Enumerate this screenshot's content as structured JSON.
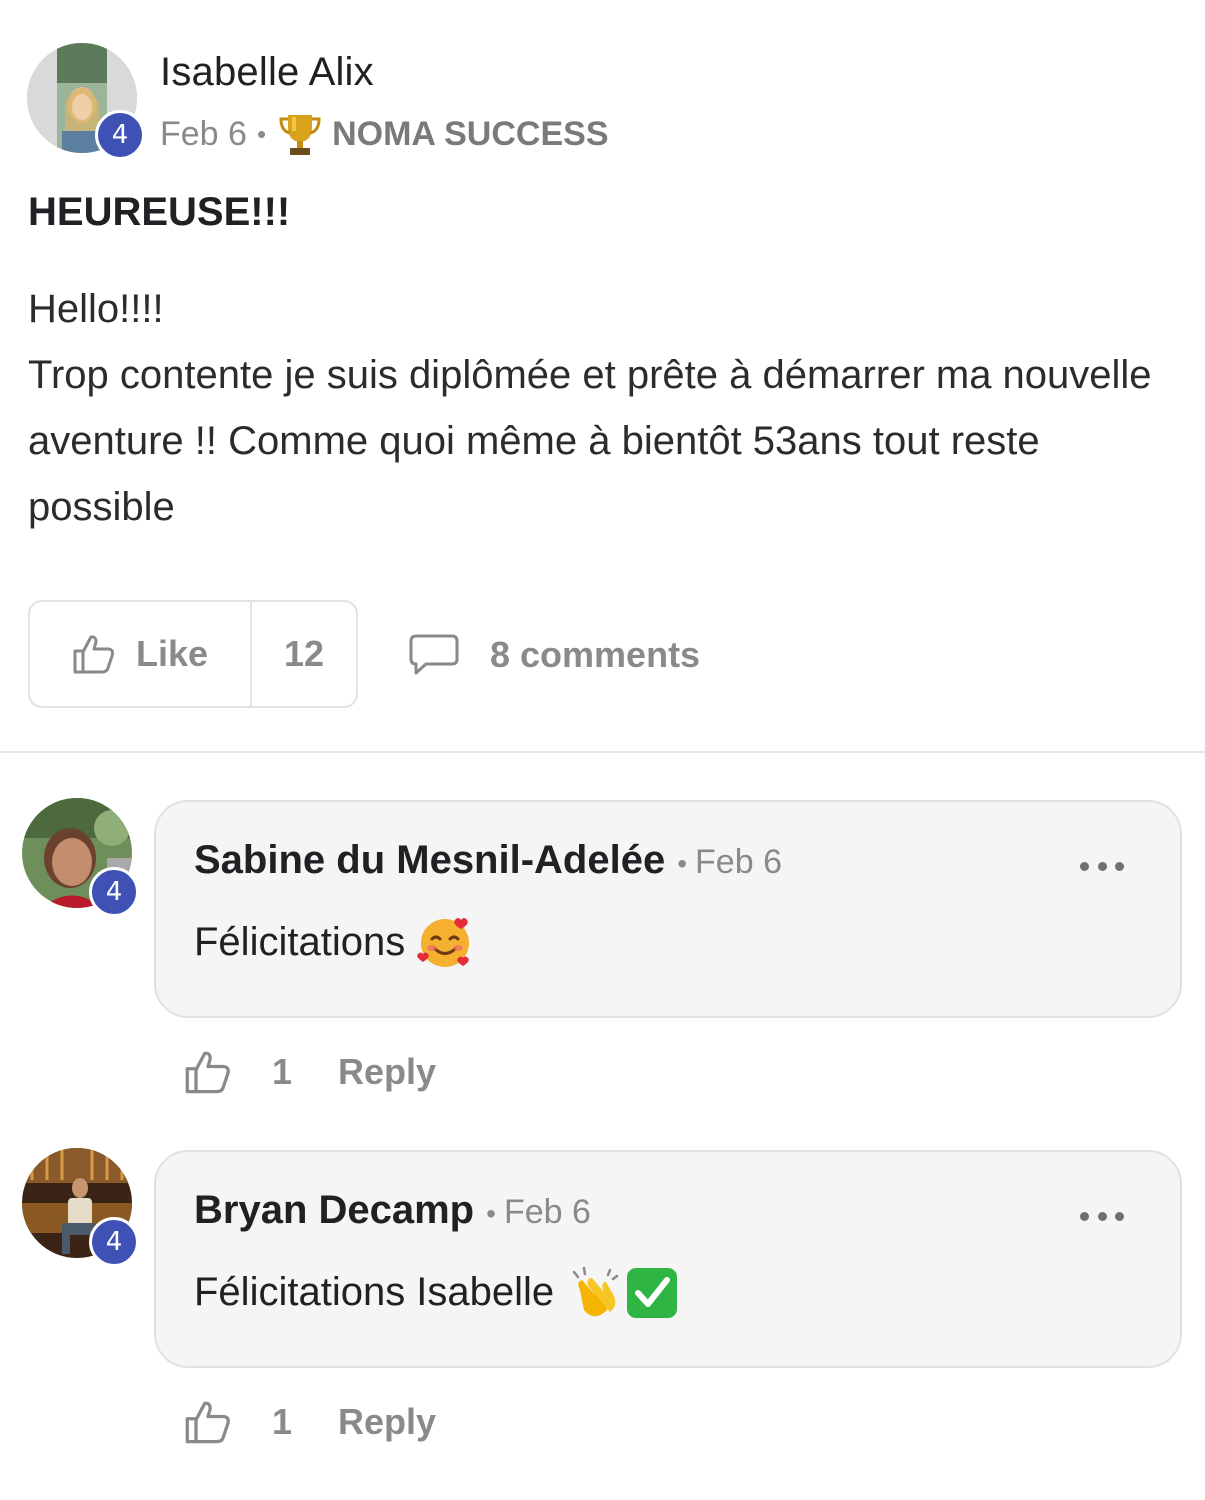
{
  "post": {
    "author": "Isabelle Alix",
    "author_level": "4",
    "date": "Feb 6",
    "separator": "•",
    "category": "NOMA SUCCESS",
    "category_icon": "trophy-icon",
    "title": "HEUREUSE!!!",
    "body_lines": [
      "Hello!!!!",
      "Trop contente je suis diplômée et prête à démarrer ma nouvelle aventure !! Comme quoi même à bientôt 53ans tout reste possible"
    ],
    "like_label": "Like",
    "like_count": "12",
    "comments_label": "8 comments"
  },
  "comments": [
    {
      "author": "Sabine du Mesnil-Adelée",
      "author_level": "4",
      "separator": "•",
      "date": "Feb 6",
      "text": "Félicitations",
      "emoji": "smiling-face-with-hearts",
      "like_count": "1",
      "reply_label": "Reply"
    },
    {
      "author": "Bryan Decamp",
      "author_level": "4",
      "separator": "•",
      "date": "Feb 6",
      "text": "Félicitations Isabelle",
      "emoji": "clapping-hands, check-mark-button",
      "like_count": "1",
      "reply_label": "Reply"
    }
  ],
  "colors": {
    "badge": "#3f51b5",
    "muted_text": "#8a8a8a",
    "bubble_bg": "#f5f5f5",
    "border": "#e2e2e2"
  }
}
